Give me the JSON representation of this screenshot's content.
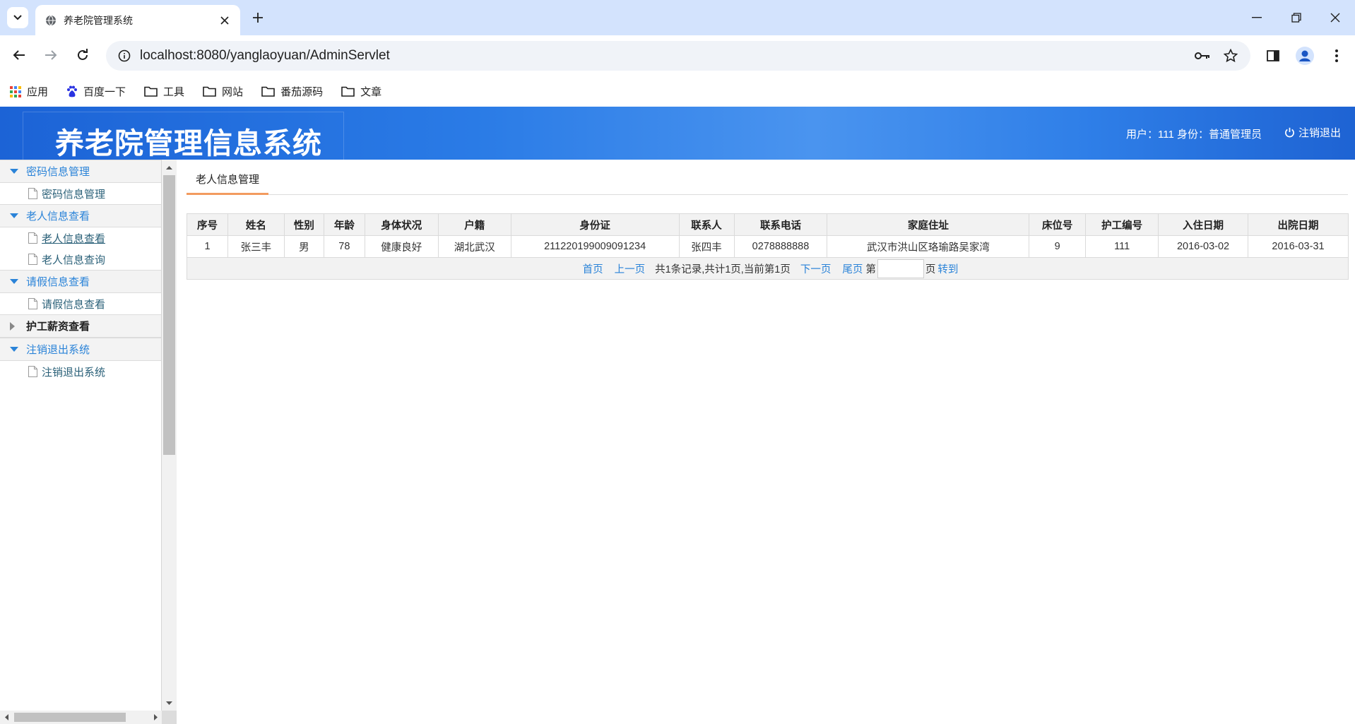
{
  "browser": {
    "tab_title": "养老院管理系统",
    "url": "localhost:8080/yanglaoyuan/AdminServlet",
    "bookmarks": [
      {
        "label": "应用",
        "icon": "apps-grid-icon"
      },
      {
        "label": "百度一下",
        "icon": "baidu-paw-icon"
      },
      {
        "label": "工具",
        "icon": "folder-icon"
      },
      {
        "label": "网站",
        "icon": "folder-icon"
      },
      {
        "label": "番茄源码",
        "icon": "folder-icon"
      },
      {
        "label": "文章",
        "icon": "folder-icon"
      }
    ]
  },
  "header": {
    "title": "养老院管理信息系统",
    "user_info": "用户：111 身份：普通管理员",
    "logout_label": "注销退出"
  },
  "sidebar": {
    "groups": [
      {
        "label": "密码信息管理",
        "expanded": true,
        "items": [
          {
            "label": "密码信息管理",
            "active": false
          }
        ]
      },
      {
        "label": "老人信息查看",
        "expanded": true,
        "items": [
          {
            "label": "老人信息查看",
            "active": true
          },
          {
            "label": "老人信息查询",
            "active": false
          }
        ]
      },
      {
        "label": "请假信息查看",
        "expanded": true,
        "items": [
          {
            "label": "请假信息查看",
            "active": false
          }
        ]
      },
      {
        "label": "护工薪资查看",
        "expanded": false,
        "items": []
      },
      {
        "label": "注销退出系统",
        "expanded": true,
        "items": [
          {
            "label": "注销退出系统",
            "active": false
          }
        ]
      }
    ]
  },
  "main": {
    "tab_label": "老人信息管理",
    "table": {
      "columns": [
        "序号",
        "姓名",
        "性别",
        "年龄",
        "身体状况",
        "户籍",
        "身份证",
        "联系人",
        "联系电话",
        "家庭住址",
        "床位号",
        "护工编号",
        "入住日期",
        "出院日期"
      ],
      "rows": [
        [
          "1",
          "张三丰",
          "男",
          "78",
          "健康良好",
          "湖北武汉",
          "211220199009091234",
          "张四丰",
          "0278888888",
          "武汉市洪山区珞瑜路吴家湾",
          "9",
          "111",
          "2016-03-02",
          "2016-03-31"
        ]
      ]
    },
    "pager": {
      "first": "首页",
      "prev": "上一页",
      "summary": "共1条记录,共计1页,当前第1页",
      "next": "下一页",
      "last": "尾页",
      "page_prefix": "第",
      "page_suffix": "页",
      "go": "转到",
      "input_value": ""
    }
  },
  "colors": {
    "accent_blue": "#2a83d8",
    "header_blue": "#2a7be6",
    "tab_underline": "#f29b5f"
  }
}
